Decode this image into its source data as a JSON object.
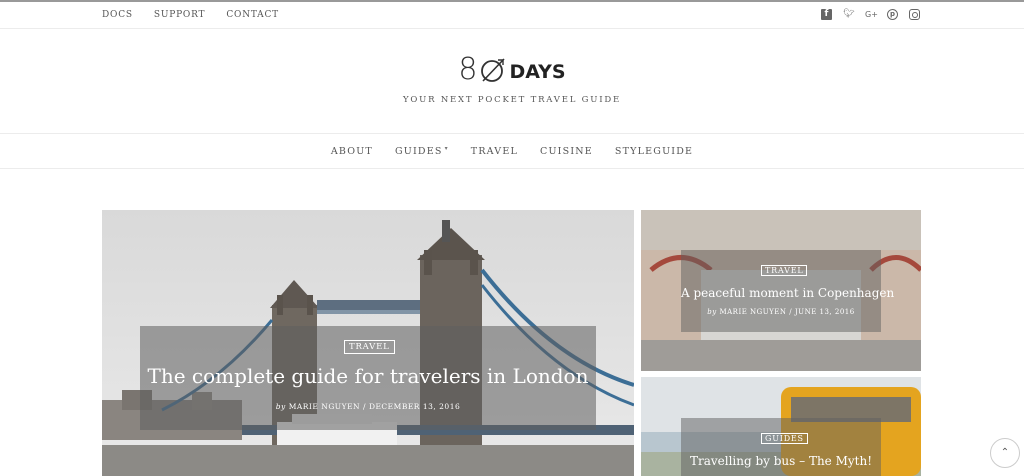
{
  "topbar": {
    "links": [
      "DOCS",
      "SUPPORT",
      "CONTACT"
    ],
    "social": [
      "facebook-icon",
      "twitter-icon",
      "google-plus-icon",
      "pinterest-icon",
      "instagram-icon"
    ]
  },
  "brand": {
    "logo_number": "8",
    "logo_word": "DAYS",
    "tagline": "YOUR NEXT POCKET TRAVEL GUIDE"
  },
  "nav": {
    "items": [
      "ABOUT",
      "GUIDES",
      "TRAVEL",
      "CUISINE",
      "STYLEGUIDE"
    ],
    "caret": "⌄"
  },
  "featured": {
    "category": "TRAVEL",
    "title": "The complete guide for travelers in London",
    "by": "by",
    "author": "MARIE NGUYEN",
    "separator": "/",
    "date": "DECEMBER 13, 2016"
  },
  "side_posts": [
    {
      "category": "TRAVEL",
      "title": "A peaceful moment in Copenhagen",
      "by": "by",
      "author": "MARIE NGUYEN",
      "separator": "/",
      "date": "JUNE 13, 2016"
    },
    {
      "category": "GUIDES",
      "title": "Travelling by bus – The Myth!"
    }
  ],
  "back_to_top": "⌃",
  "colors": {
    "text": "#333333",
    "overlay": "#5f5f5f",
    "accent_blue": "#3c6e96"
  }
}
